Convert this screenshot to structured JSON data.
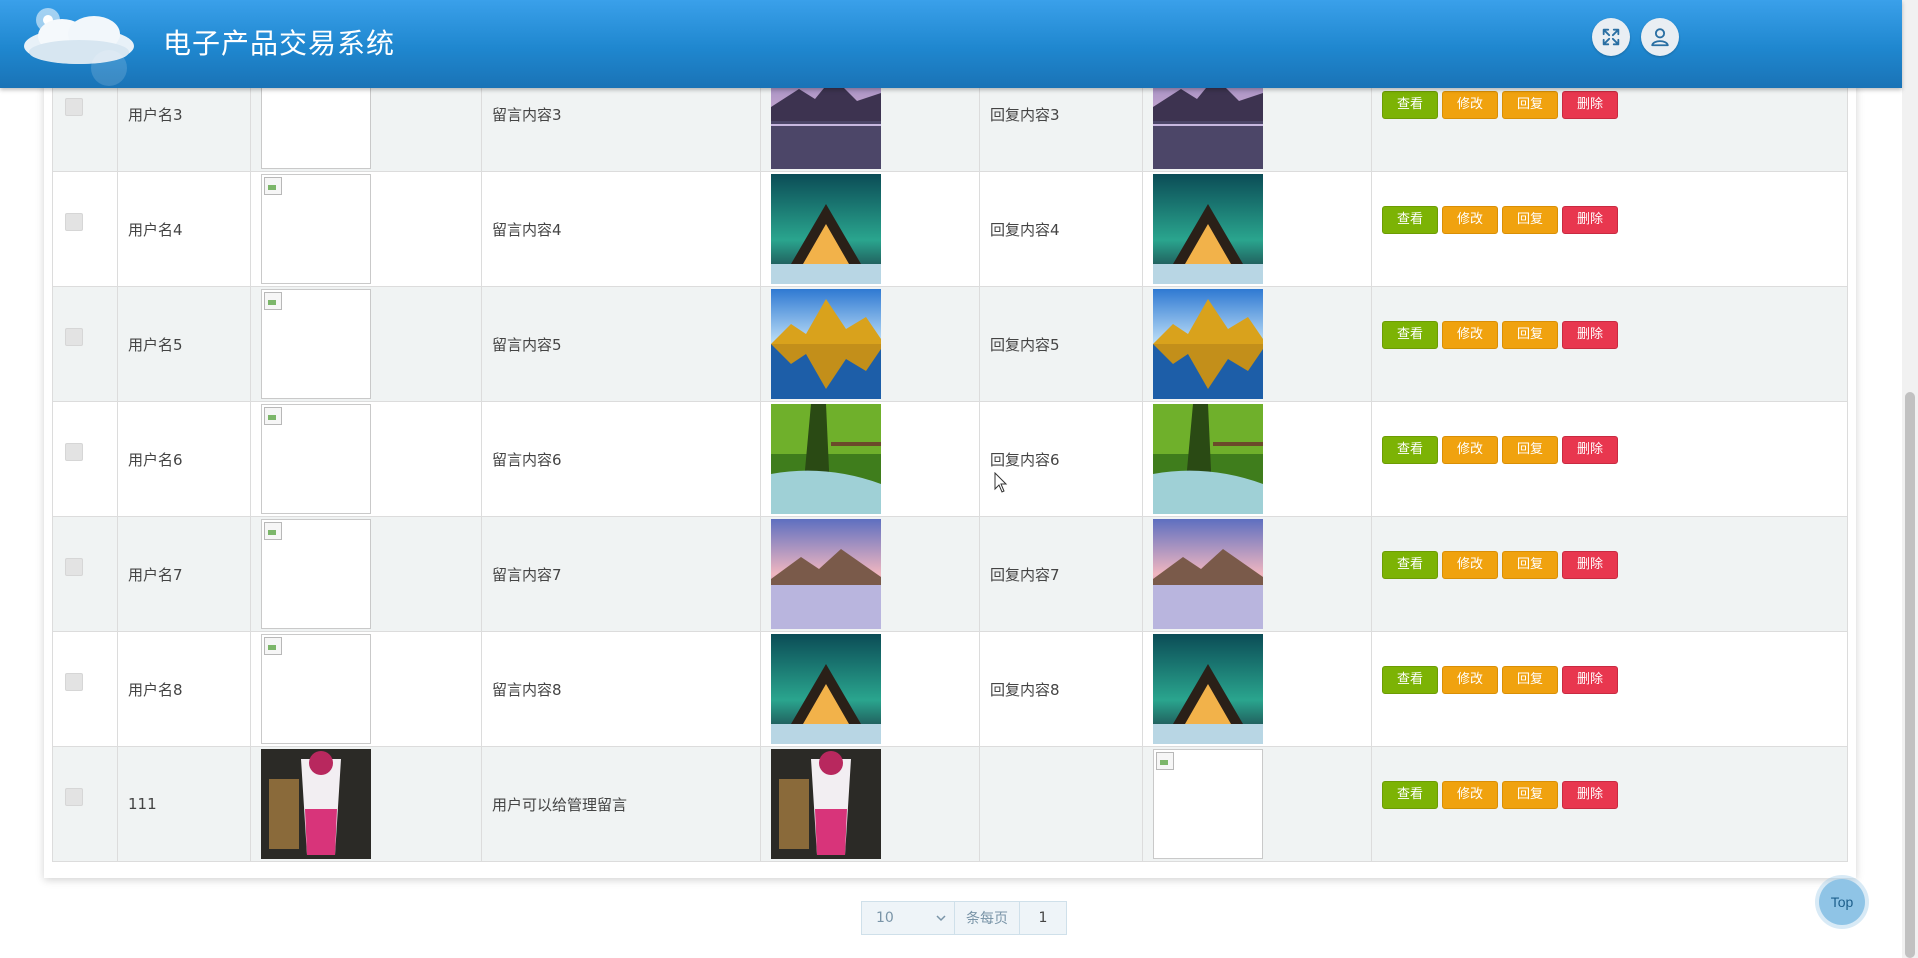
{
  "header": {
    "title": "电子产品交易系统",
    "fullscreen_icon": "fullscreen-icon",
    "user_icon": "user-icon"
  },
  "table": {
    "actions": {
      "view": "查看",
      "edit": "修改",
      "reply": "回复",
      "delete": "删除"
    },
    "rows": [
      {
        "user": "用户名3",
        "message": "留言内容3",
        "reply": "回复内容3",
        "avatar": "broken",
        "msg_image": "mountain-lake-purple",
        "reply_image": "mountain-lake-purple"
      },
      {
        "user": "用户名4",
        "message": "留言内容4",
        "reply": "回复内容4",
        "avatar": "broken",
        "msg_image": "aurora-cabin",
        "reply_image": "aurora-cabin"
      },
      {
        "user": "用户名5",
        "message": "留言内容5",
        "reply": "回复内容5",
        "avatar": "broken",
        "msg_image": "golden-mountain-lake",
        "reply_image": "golden-mountain-lake"
      },
      {
        "user": "用户名6",
        "message": "留言内容6",
        "reply": "回复内容6",
        "avatar": "broken",
        "msg_image": "forest-waterfall",
        "reply_image": "forest-waterfall"
      },
      {
        "user": "用户名7",
        "message": "留言内容7",
        "reply": "回复内容7",
        "avatar": "broken",
        "msg_image": "pastel-mountain-lake",
        "reply_image": "pastel-mountain-lake"
      },
      {
        "user": "用户名8",
        "message": "留言内容8",
        "reply": "回复内容8",
        "avatar": "broken",
        "msg_image": "aurora-cabin",
        "reply_image": "aurora-cabin"
      },
      {
        "user": "111",
        "message": "用户可以给管理留言",
        "reply": "",
        "avatar": "pink-drink",
        "msg_image": "pink-drink",
        "reply_image": "broken"
      }
    ]
  },
  "pagination": {
    "page_size": "10",
    "per_page_label": "条每页",
    "current_page": "1"
  },
  "back_to_top": "Top",
  "colors": {
    "header": "#1f87cf",
    "view": "#7cb305",
    "edit": "#f0a20f",
    "delete": "#e8374f"
  }
}
